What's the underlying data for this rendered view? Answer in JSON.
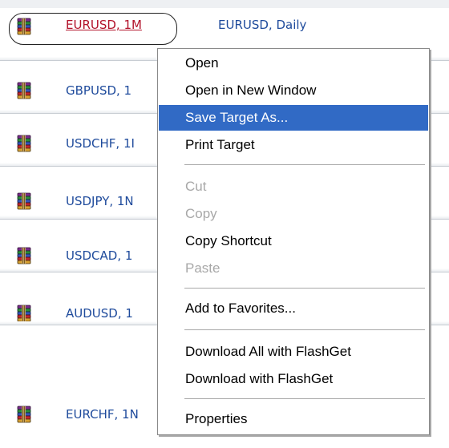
{
  "files": [
    {
      "name": "EURUSD, 1M",
      "second": "EURUSD, Daily",
      "visited": true
    },
    {
      "name": "GBPUSD, 1",
      "second": "",
      "visited": false
    },
    {
      "name": "USDCHF, 1I",
      "second": "",
      "visited": false
    },
    {
      "name": "USDJPY, 1N",
      "second": "",
      "visited": false
    },
    {
      "name": "USDCAD, 1",
      "second": "",
      "visited": false
    },
    {
      "name": "AUDUSD, 1",
      "second": "",
      "visited": false
    },
    {
      "name": "EURCHF, 1N",
      "second": "",
      "visited": false
    }
  ],
  "file_icon": "winrar-archive-icon",
  "context_menu": {
    "items": [
      {
        "label": "Open",
        "state": "normal"
      },
      {
        "label": "Open in New Window",
        "state": "normal"
      },
      {
        "label": "Save Target As...",
        "state": "highlighted"
      },
      {
        "label": "Print Target",
        "state": "normal"
      },
      {
        "label": "Cut",
        "state": "disabled"
      },
      {
        "label": "Copy",
        "state": "disabled"
      },
      {
        "label": "Copy Shortcut",
        "state": "normal"
      },
      {
        "label": "Paste",
        "state": "disabled"
      },
      {
        "label": "Add to Favorites...",
        "state": "normal"
      },
      {
        "label": "Download All with FlashGet",
        "state": "normal"
      },
      {
        "label": "Download with FlashGet",
        "state": "normal"
      },
      {
        "label": "Properties",
        "state": "normal"
      }
    ]
  },
  "colors": {
    "link": "#1f4b9c",
    "visited_link": "#b3132b",
    "menu_highlight": "#316ac5",
    "disabled_text": "#a8a8a8"
  }
}
